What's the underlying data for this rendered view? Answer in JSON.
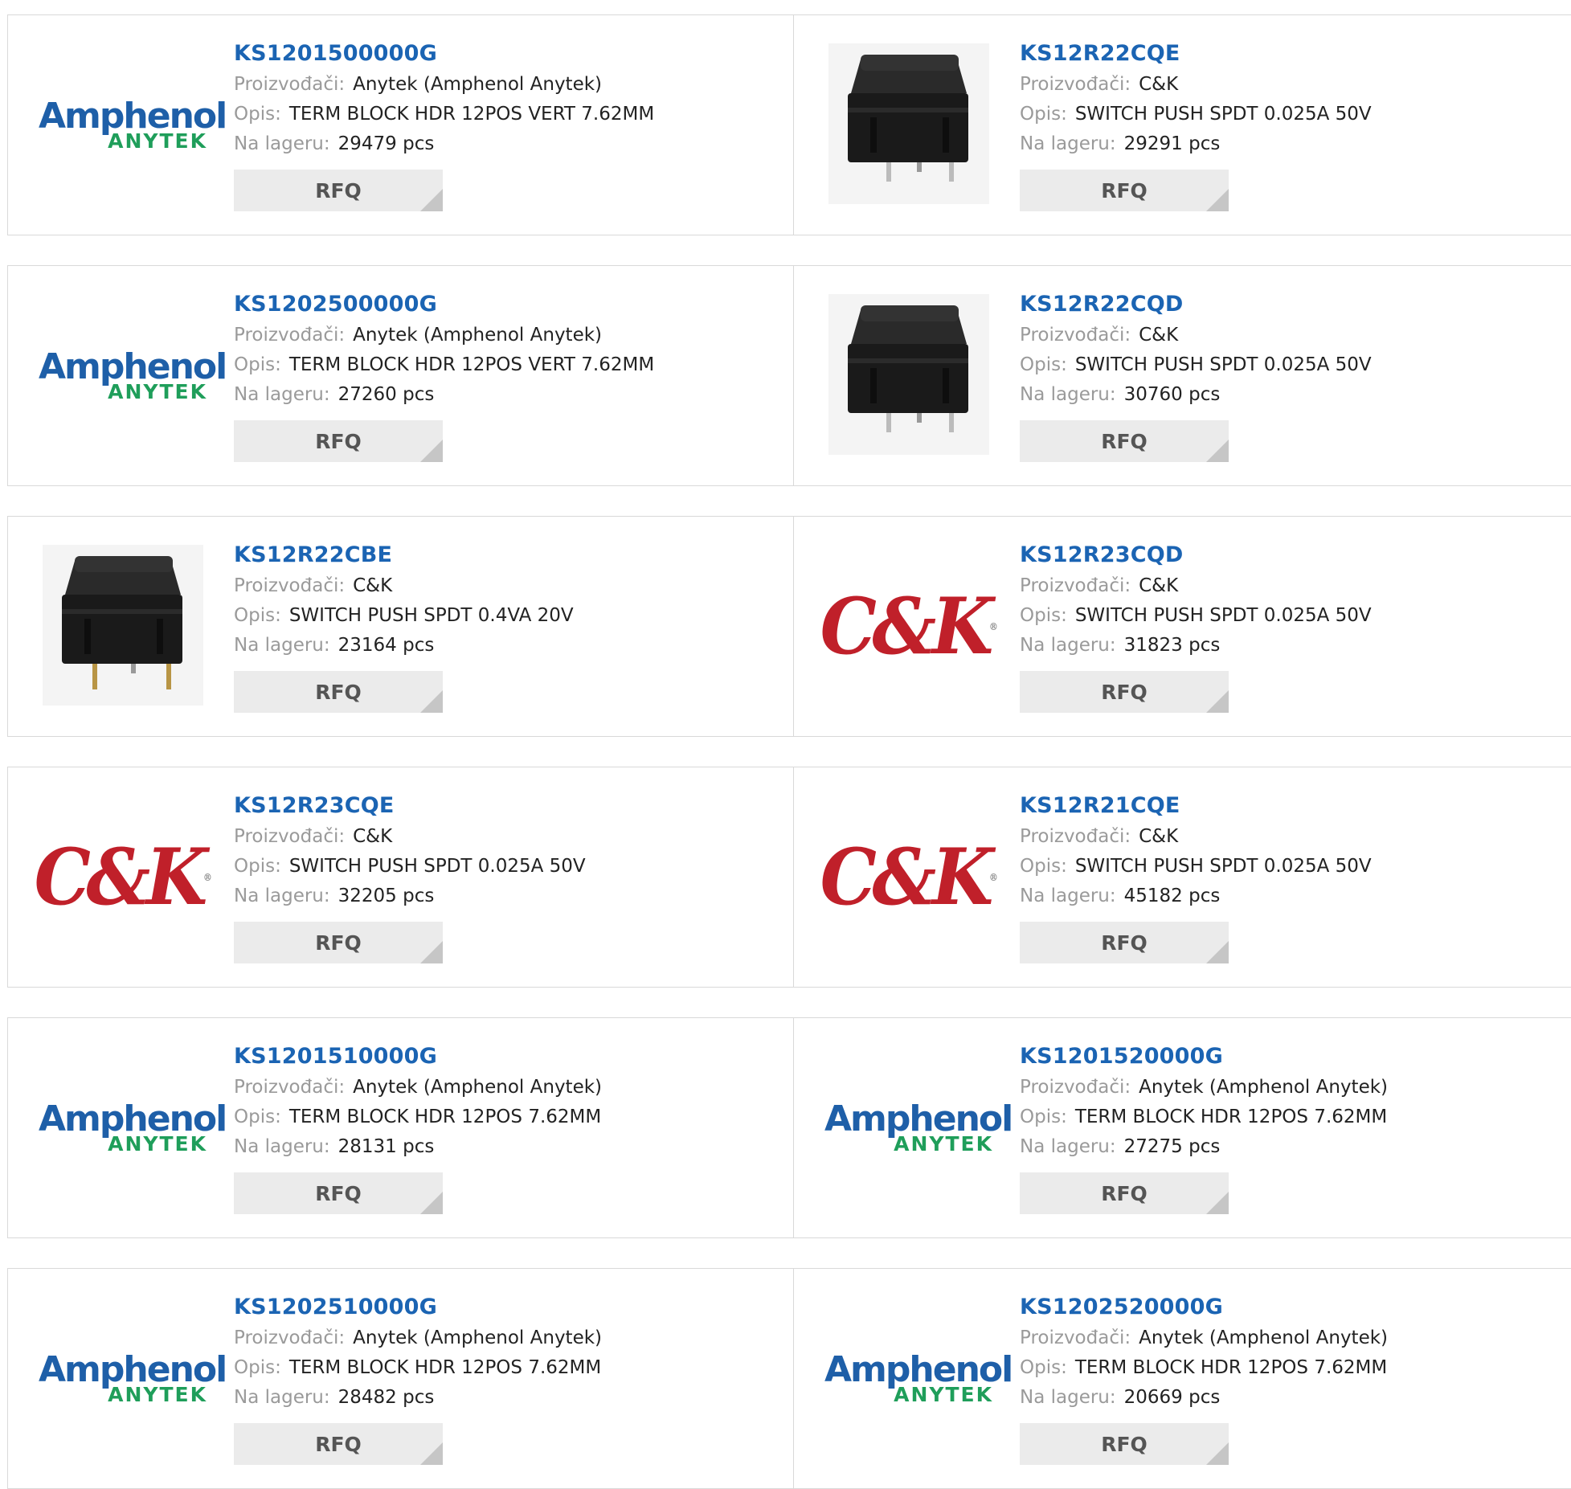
{
  "labels": {
    "manufacturer": "Proizvođači:",
    "description": "Opis:",
    "stock": "Na lageru:",
    "rfq": "RFQ"
  },
  "logos": {
    "amphenol": {
      "line1": "Amphenol",
      "line2": "ANYTEK"
    },
    "ck": {
      "text": "C&K",
      "mark": "®"
    }
  },
  "colors": {
    "link": "#1b64b3",
    "amphenol_blue": "#1e5fa8",
    "anytek_green": "#1f9e5a",
    "ck_red": "#c0202a",
    "rfq_bg": "#ebebeb"
  },
  "products": [
    {
      "part": "KS1201500000G",
      "manufacturer": "Anytek (Amphenol Anytek)",
      "description": "TERM BLOCK HDR 12POS VERT 7.62MM",
      "stock": "29479 pcs",
      "image": "amphenol"
    },
    {
      "part": "KS12R22CQE",
      "manufacturer": "C&K",
      "description": "SWITCH PUSH SPDT 0.025A 50V",
      "stock": "29291 pcs",
      "image": "switch-silver"
    },
    {
      "part": "KS1202500000G",
      "manufacturer": "Anytek (Amphenol Anytek)",
      "description": "TERM BLOCK HDR 12POS VERT 7.62MM",
      "stock": "27260 pcs",
      "image": "amphenol"
    },
    {
      "part": "KS12R22CQD",
      "manufacturer": "C&K",
      "description": "SWITCH PUSH SPDT 0.025A 50V",
      "stock": "30760 pcs",
      "image": "switch-silver"
    },
    {
      "part": "KS12R22CBE",
      "manufacturer": "C&K",
      "description": "SWITCH PUSH SPDT 0.4VA 20V",
      "stock": "23164 pcs",
      "image": "switch-gold"
    },
    {
      "part": "KS12R23CQD",
      "manufacturer": "C&K",
      "description": "SWITCH PUSH SPDT 0.025A 50V",
      "stock": "31823 pcs",
      "image": "ck"
    },
    {
      "part": "KS12R23CQE",
      "manufacturer": "C&K",
      "description": "SWITCH PUSH SPDT 0.025A 50V",
      "stock": "32205 pcs",
      "image": "ck"
    },
    {
      "part": "KS12R21CQE",
      "manufacturer": "C&K",
      "description": "SWITCH PUSH SPDT 0.025A 50V",
      "stock": "45182 pcs",
      "image": "ck"
    },
    {
      "part": "KS1201510000G",
      "manufacturer": "Anytek (Amphenol Anytek)",
      "description": "TERM BLOCK HDR 12POS 7.62MM",
      "stock": "28131 pcs",
      "image": "amphenol"
    },
    {
      "part": "KS1201520000G",
      "manufacturer": "Anytek (Amphenol Anytek)",
      "description": "TERM BLOCK HDR 12POS 7.62MM",
      "stock": "27275 pcs",
      "image": "amphenol"
    },
    {
      "part": "KS1202510000G",
      "manufacturer": "Anytek (Amphenol Anytek)",
      "description": "TERM BLOCK HDR 12POS 7.62MM",
      "stock": "28482 pcs",
      "image": "amphenol"
    },
    {
      "part": "KS1202520000G",
      "manufacturer": "Anytek (Amphenol Anytek)",
      "description": "TERM BLOCK HDR 12POS 7.62MM",
      "stock": "20669 pcs",
      "image": "amphenol"
    }
  ]
}
